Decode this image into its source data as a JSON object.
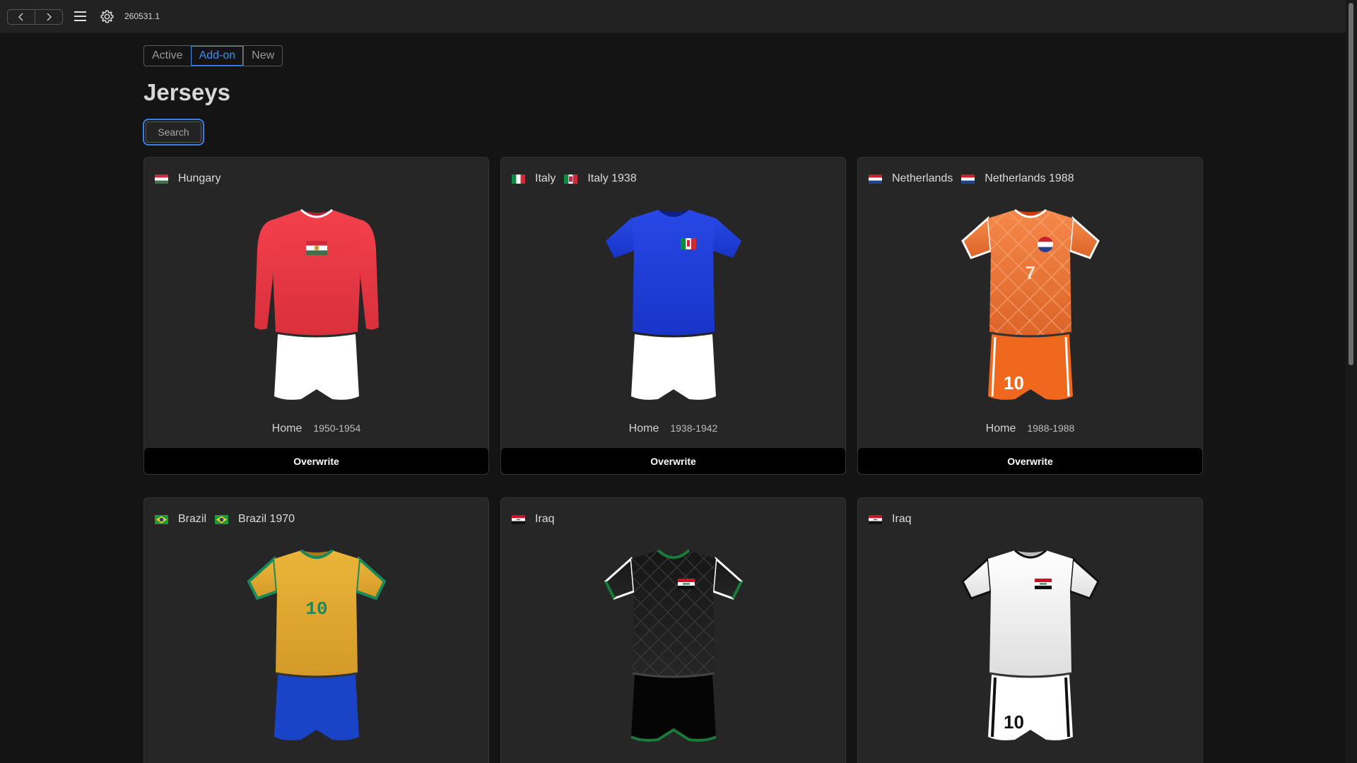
{
  "topbar": {
    "back_icon": "chevron-left-icon",
    "forward_icon": "chevron-right-icon",
    "menu_icon": "hamburger-menu-icon",
    "settings_icon": "gear-icon",
    "version": "260531.1"
  },
  "tabs": [
    {
      "label": "Active",
      "selected": false
    },
    {
      "label": "Add-on",
      "selected": true
    },
    {
      "label": "New",
      "selected": false
    }
  ],
  "page_title": "Jerseys",
  "search_label": "Search",
  "cards": [
    {
      "team": "Hungary",
      "variant": "",
      "type": "Home",
      "years": "1950-1954",
      "action": "Overwrite"
    },
    {
      "team": "Italy",
      "variant": "Italy 1938",
      "type": "Home",
      "years": "1938-1942",
      "action": "Overwrite"
    },
    {
      "team": "Netherlands",
      "variant": "Netherlands 1988",
      "type": "Home",
      "years": "1988-1988",
      "action": "Overwrite",
      "shirt_number": "7",
      "shorts_number": "10"
    },
    {
      "team": "Brazil",
      "variant": "Brazil 1970",
      "shirt_number": "10"
    },
    {
      "team": "Iraq",
      "variant": ""
    },
    {
      "team": "Iraq",
      "variant": "",
      "shorts_number": "10"
    }
  ],
  "colors": {
    "accent": "#3d8ff5",
    "hungary_shirt": "#f0404a",
    "italy_shirt": "#2440e0",
    "netherlands_shirt": "#f07a3a",
    "brazil_shirt": "#e8b030",
    "brazil_shorts": "#1a44c8"
  }
}
